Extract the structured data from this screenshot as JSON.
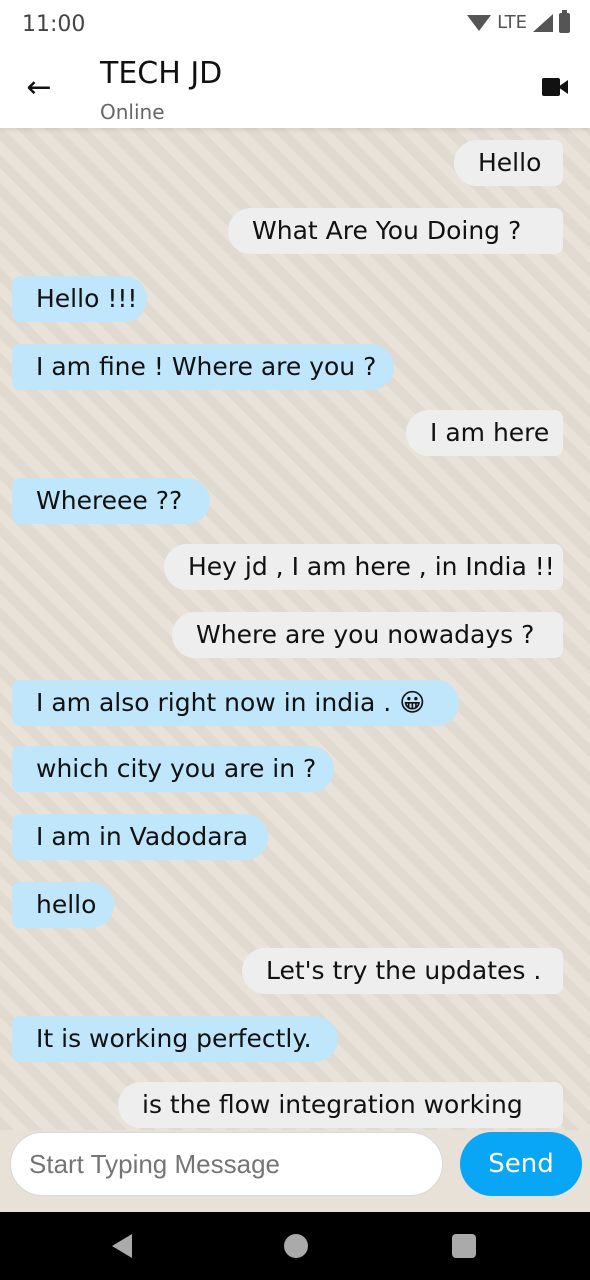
{
  "status_bar": {
    "time": "11:00",
    "network": "LTE"
  },
  "header": {
    "title": "TECH JD",
    "subtitle": "Online",
    "back_icon": "arrow-left-icon",
    "video_icon": "video-camera-icon"
  },
  "messages": [
    {
      "direction": "out",
      "text": "Hello"
    },
    {
      "direction": "out",
      "text": "What Are You Doing ?"
    },
    {
      "direction": "in",
      "text": "Hello !!!"
    },
    {
      "direction": "in",
      "text": "I am fine ! Where are you ?"
    },
    {
      "direction": "out",
      "text": "I am here"
    },
    {
      "direction": "in",
      "text": "Whereee ??"
    },
    {
      "direction": "out",
      "text": "Hey jd , I am here , in India !!"
    },
    {
      "direction": "out",
      "text": "Where are you nowadays ?"
    },
    {
      "direction": "in",
      "text": "I am also right now in india . 😀"
    },
    {
      "direction": "in",
      "text": "which city you are in ?"
    },
    {
      "direction": "in",
      "text": "I am in Vadodara"
    },
    {
      "direction": "in",
      "text": "hello"
    },
    {
      "direction": "out",
      "text": "Let's try the updates ."
    },
    {
      "direction": "in",
      "text": "It is working perfectly."
    },
    {
      "direction": "out",
      "text": "is the flow integration working"
    }
  ],
  "composer": {
    "placeholder": "Start Typing Message",
    "send_label": "Send"
  },
  "colors": {
    "incoming": "#bfe6fb",
    "outgoing": "#eeeeee",
    "send": "#0aa6f6"
  }
}
